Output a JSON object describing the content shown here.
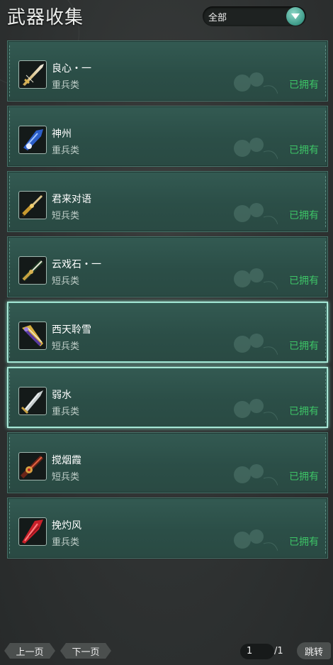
{
  "header": {
    "title": "武器收集",
    "filter_value": "全部"
  },
  "weapons": [
    {
      "name": "良心・一",
      "type": "重兵类",
      "status": "已拥有",
      "icon": "greatsword-white-gold-icon",
      "selected": false
    },
    {
      "name": "神州",
      "type": "重兵类",
      "status": "已拥有",
      "icon": "greatsword-blue-icon",
      "selected": false
    },
    {
      "name": "君来对语",
      "type": "短兵类",
      "status": "已拥有",
      "icon": "dagger-gold-icon",
      "selected": false
    },
    {
      "name": "云戏石・一",
      "type": "短兵类",
      "status": "已拥有",
      "icon": "dagger-green-gold-icon",
      "selected": false
    },
    {
      "name": "西天聆雪",
      "type": "短兵类",
      "status": "已拥有",
      "icon": "dagger-purple-gold-icon",
      "selected": true
    },
    {
      "name": "弱水",
      "type": "重兵类",
      "status": "已拥有",
      "icon": "greatsword-silver-icon",
      "selected": true
    },
    {
      "name": "搅烟霞",
      "type": "短兵类",
      "status": "已拥有",
      "icon": "dagger-red-icon",
      "selected": false
    },
    {
      "name": "挽灼风",
      "type": "重兵类",
      "status": "已拥有",
      "icon": "greatsword-red-crystal-icon",
      "selected": false
    }
  ],
  "pagination": {
    "prev_label": "上一页",
    "next_label": "下一页",
    "current_page": "1",
    "total_pages": "/1",
    "jump_label": "跳转"
  },
  "colors": {
    "owned_status": "#3dc466",
    "card_bg": "#2e524b",
    "selected_border": "#b8f0e0"
  }
}
